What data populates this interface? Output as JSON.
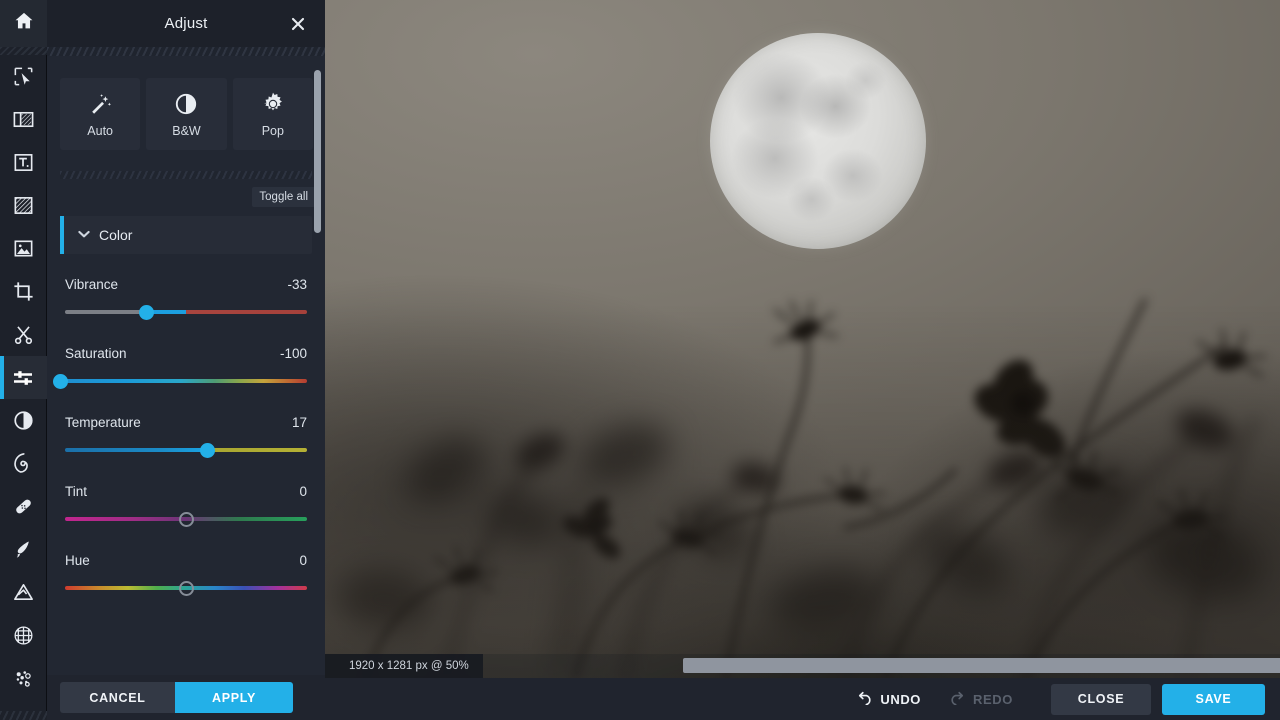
{
  "rail": {
    "home": {
      "label": "Home",
      "icon": "home-icon"
    },
    "tools": [
      {
        "id": "select",
        "label": "Select",
        "icon": "cursor-select-icon",
        "active": false
      },
      {
        "id": "layout",
        "label": "Layout",
        "icon": "layout-icon",
        "active": false
      },
      {
        "id": "text",
        "label": "Text",
        "icon": "text-icon",
        "active": false
      },
      {
        "id": "pattern",
        "label": "Pattern",
        "icon": "pattern-icon",
        "active": false
      },
      {
        "id": "image",
        "label": "Image",
        "icon": "image-icon",
        "active": false
      },
      {
        "id": "crop",
        "label": "Crop",
        "icon": "crop-icon",
        "active": false
      },
      {
        "id": "cut",
        "label": "Cut",
        "icon": "scissors-icon",
        "active": false
      },
      {
        "id": "adjust",
        "label": "Adjust",
        "icon": "sliders-icon",
        "active": true
      },
      {
        "id": "contrast",
        "label": "Effects",
        "icon": "contrast-icon",
        "active": false
      },
      {
        "id": "blur",
        "label": "Blur",
        "icon": "spiral-icon",
        "active": false
      },
      {
        "id": "heal",
        "label": "Heal",
        "icon": "bandage-icon",
        "active": false
      },
      {
        "id": "brush",
        "label": "Brush",
        "icon": "brush-icon",
        "active": false
      },
      {
        "id": "shapes",
        "label": "Shapes",
        "icon": "triangle-icon",
        "active": false
      },
      {
        "id": "texture",
        "label": "Texture",
        "icon": "globe-grid-icon",
        "active": false
      },
      {
        "id": "frames",
        "label": "Frames",
        "icon": "bokeh-dots-icon",
        "active": false
      }
    ]
  },
  "panel": {
    "title": "Adjust",
    "close_icon": "close-icon",
    "presets": [
      {
        "label": "Auto",
        "icon": "magic-wand-icon"
      },
      {
        "label": "B&W",
        "icon": "contrast-circle-icon"
      },
      {
        "label": "Pop",
        "icon": "sun-burst-icon"
      }
    ],
    "toggle_all_label": "Toggle all",
    "section": {
      "title": "Color",
      "expanded": true,
      "chevron_icon": "chevron-down-icon",
      "accent_color": "#23b0e8"
    },
    "sliders": [
      {
        "name": "Vibrance",
        "value": "-33",
        "thumb_pct": 34.5,
        "filled": true,
        "style": "vibrance"
      },
      {
        "name": "Saturation",
        "value": "-100",
        "thumb_pct": 0.0,
        "filled": true,
        "style": "saturation"
      },
      {
        "name": "Temperature",
        "value": "17",
        "thumb_pct": 58.5,
        "filled": true,
        "style": "temperature"
      },
      {
        "name": "Tint",
        "value": "0",
        "thumb_pct": 50.0,
        "filled": false,
        "style": "tint"
      },
      {
        "name": "Hue",
        "value": "0",
        "thumb_pct": 50.0,
        "filled": false,
        "style": "hue"
      }
    ],
    "footer": {
      "cancel_label": "CANCEL",
      "apply_label": "APPLY"
    }
  },
  "canvas": {
    "status_text": "1920 x 1281 px @ 50%",
    "subject": "full moon over silhouetted cosmos flowers"
  },
  "bottombar": {
    "undo_label": "UNDO",
    "undo_icon": "undo-arrow-icon",
    "undo_enabled": true,
    "redo_label": "REDO",
    "redo_icon": "redo-arrow-icon",
    "redo_enabled": false,
    "close_label": "CLOSE",
    "save_label": "SAVE"
  },
  "colors": {
    "accent": "#23b0e8",
    "panel_bg": "#222732",
    "rail_bg": "#1d212a",
    "bar_bg": "#20242e",
    "text": "#e6ebf1"
  }
}
